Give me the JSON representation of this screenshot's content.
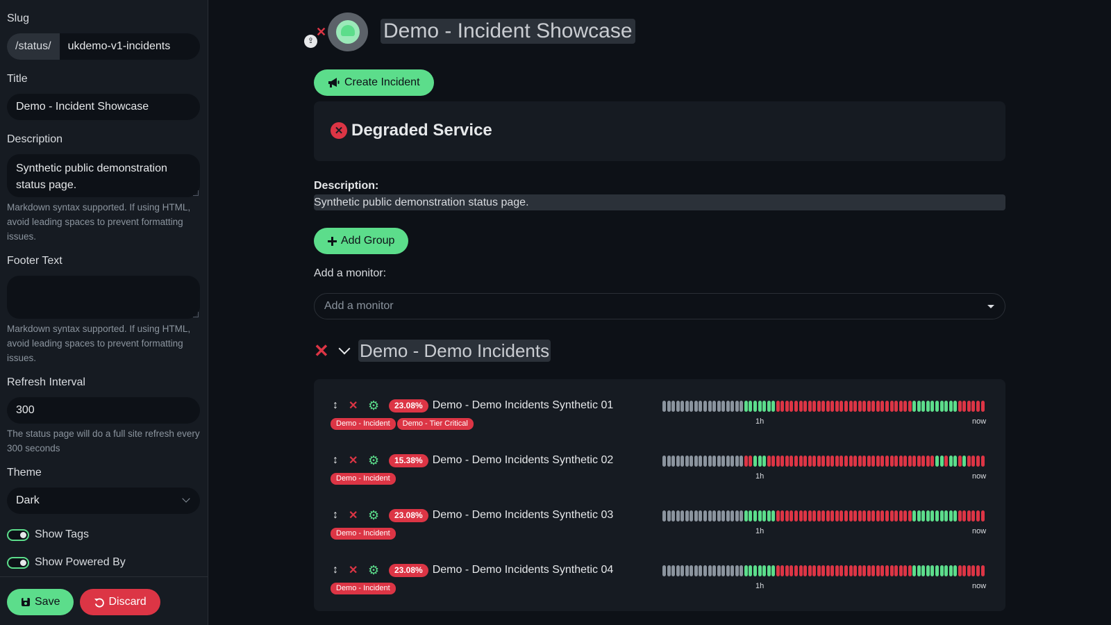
{
  "sidebar": {
    "slug_label": "Slug",
    "slug_prefix": "/status/",
    "slug_value": "ukdemo-v1-incidents",
    "title_label": "Title",
    "title_value": "Demo - Incident Showcase",
    "description_label": "Description",
    "description_value": "Synthetic public demonstration status page.",
    "description_hint": "Markdown syntax supported. If using HTML, avoid leading spaces to prevent formatting issues.",
    "footer_label": "Footer Text",
    "footer_value": "",
    "footer_hint": "Markdown syntax supported. If using HTML, avoid leading spaces to prevent formatting issues.",
    "refresh_label": "Refresh Interval",
    "refresh_value": "300",
    "refresh_hint": "The status page will do a full site refresh every 300 seconds",
    "theme_label": "Theme",
    "theme_value": "Dark",
    "show_tags_label": "Show Tags",
    "show_powered_by_label": "Show Powered By",
    "save_label": "Save",
    "discard_label": "Discard"
  },
  "header": {
    "page_title": "Demo - Incident Showcase"
  },
  "main": {
    "create_incident_label": "Create Incident",
    "status_title": "Degraded Service",
    "description_label": "Description:",
    "description_text": "Synthetic public demonstration status page.",
    "add_group_label": "Add Group",
    "add_monitor_label": "Add a monitor:",
    "add_monitor_placeholder": "Add a monitor",
    "group_title": "Demo - Demo Incidents"
  },
  "monitors": [
    {
      "uptime": "23.08%",
      "name": "Demo - Demo Incidents Synthetic 01",
      "tags": [
        "Demo - Incident",
        "Demo - Tier Critical"
      ],
      "beats": "ggggggggggggggggggGGGGGGGrrrrrrrrrrrrrrrrrrrrrrrrrrrrrrGGGGGGGGGGrrrrrr",
      "label_1h": "1h",
      "label_now": "now"
    },
    {
      "uptime": "15.38%",
      "name": "Demo - Demo Incidents Synthetic 02",
      "tags": [
        "Demo - Incident"
      ],
      "beats": "ggggggggggggggggggrrGGGrrrrrrrrrrrrrrrrrrrrrrrrrrrrrrrrrrrrrGGrGGrGrrrr",
      "label_1h": "1h",
      "label_now": "now"
    },
    {
      "uptime": "23.08%",
      "name": "Demo - Demo Incidents Synthetic 03",
      "tags": [
        "Demo - Incident"
      ],
      "beats": "ggggggggggggggggggGGGGGGGrrrrrrrrrrrrrrrrrrrrrrrrrrrrrrGGGGGGGGGGrrrrrr",
      "label_1h": "1h",
      "label_now": "now"
    },
    {
      "uptime": "23.08%",
      "name": "Demo - Demo Incidents Synthetic 04",
      "tags": [
        "Demo - Incident"
      ],
      "beats": "ggggggggggggggggggGGGGGGGrrrrrrrrrrrrrrrrrrrrrrrrrrrrrrGGGGGGGGGGrrrrrr",
      "label_1h": "1h",
      "label_now": "now"
    }
  ],
  "colors": {
    "accent_green": "#5cdd8b",
    "danger_red": "#dc3545",
    "beat_empty": "#8b949e",
    "background": "#0d1117",
    "panel": "#161b22"
  },
  "icons": {
    "create_incident": "megaphone-icon",
    "status": "x-circle-icon",
    "add_group": "plus-icon",
    "save": "floppy-disk-icon",
    "discard": "undo-icon",
    "drag": "drag-handle-icon",
    "remove": "close-icon",
    "settings": "gear-icon"
  }
}
